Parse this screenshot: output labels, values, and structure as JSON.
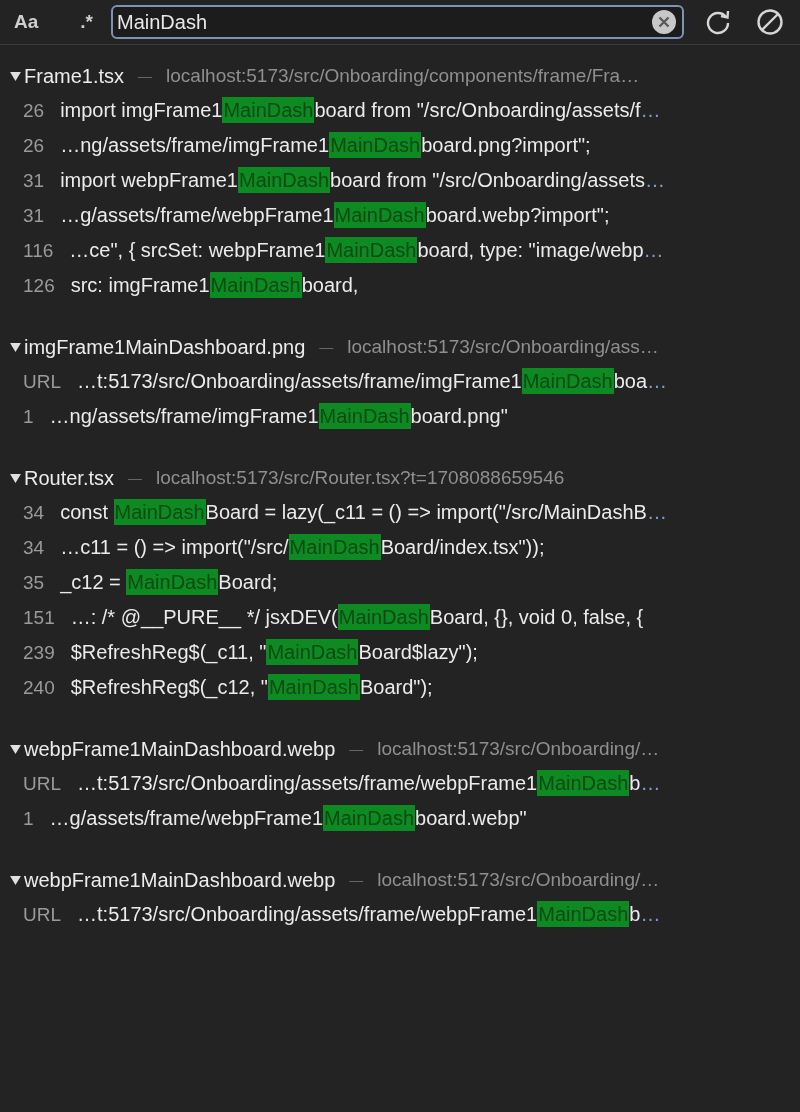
{
  "toolbar": {
    "case_toggle": "Aa",
    "regex_toggle": ".*",
    "search": {
      "value": "MainDash"
    }
  },
  "groups": [
    {
      "file": "Frame1.tsx",
      "separator": "—",
      "location": "localhost:5173/src/Onboarding/components/frame/Fra…",
      "expanded": true,
      "rows": [
        {
          "line": "26",
          "before": "import imgFrame1",
          "match": "MainDash",
          "after": "board from \"/src/Onboarding/assets/f",
          "more": "…"
        },
        {
          "line": "26",
          "before": "…ng/assets/frame/imgFrame1",
          "match": "MainDash",
          "after": "board.png?import\";"
        },
        {
          "line": "31",
          "before": "import webpFrame1",
          "match": "MainDash",
          "after": "board from \"/src/Onboarding/assets",
          "more": "…"
        },
        {
          "line": "31",
          "before": "…g/assets/frame/webpFrame1",
          "match": "MainDash",
          "after": "board.webp?import\";"
        },
        {
          "line": "116",
          "before": "…ce\", { srcSet: webpFrame1",
          "match": "MainDash",
          "after": "board, type: \"image/webp",
          "more": "…"
        },
        {
          "line": "126",
          "before": "src: imgFrame1",
          "match": "MainDash",
          "after": "board,"
        }
      ]
    },
    {
      "file": "imgFrame1MainDashboard.png",
      "separator": "—",
      "location": "localhost:5173/src/Onboarding/ass…",
      "expanded": true,
      "rows": [
        {
          "line": "URL",
          "before": "…t:5173/src/Onboarding/assets/frame/imgFrame1",
          "match": "MainDash",
          "after": "boa",
          "more": "…"
        },
        {
          "line": "1",
          "before": "…ng/assets/frame/imgFrame1",
          "match": "MainDash",
          "after": "board.png\""
        }
      ]
    },
    {
      "file": "Router.tsx",
      "separator": "—",
      "location": "localhost:5173/src/Router.tsx?t=1708088659546",
      "expanded": true,
      "rows": [
        {
          "line": "34",
          "before": "const ",
          "match": "MainDash",
          "after": "Board = lazy(_c11 = () => import(\"/src/MainDashB",
          "more": "…"
        },
        {
          "line": "34",
          "before": "…c11 = () => import(\"/src/",
          "match": "MainDash",
          "after": "Board/index.tsx\"));"
        },
        {
          "line": "35",
          "before": "_c12 = ",
          "match": "MainDash",
          "after": "Board;"
        },
        {
          "line": "151",
          "before": "…: /* @__PURE__ */ jsxDEV(",
          "match": "MainDash",
          "after": "Board, {}, void 0, false, {"
        },
        {
          "line": "239",
          "before": "$RefreshReg$(_c11, \"",
          "match": "MainDash",
          "after": "Board$lazy\");"
        },
        {
          "line": "240",
          "before": "$RefreshReg$(_c12, \"",
          "match": "MainDash",
          "after": "Board\");"
        }
      ]
    },
    {
      "file": "webpFrame1MainDashboard.webp",
      "separator": "—",
      "location": "localhost:5173/src/Onboarding/…",
      "expanded": true,
      "rows": [
        {
          "line": "URL",
          "before": "…t:5173/src/Onboarding/assets/frame/webpFrame1",
          "match": "MainDash",
          "after": "b",
          "more": "…"
        },
        {
          "line": "1",
          "before": "…g/assets/frame/webpFrame1",
          "match": "MainDash",
          "after": "board.webp\""
        }
      ]
    },
    {
      "file": "webpFrame1MainDashboard.webp",
      "separator": "—",
      "location": "localhost:5173/src/Onboarding/…",
      "expanded": true,
      "rows": [
        {
          "line": "URL",
          "before": "…t:5173/src/Onboarding/assets/frame/webpFrame1",
          "match": "MainDash",
          "after": "b",
          "more": "…"
        }
      ]
    }
  ]
}
